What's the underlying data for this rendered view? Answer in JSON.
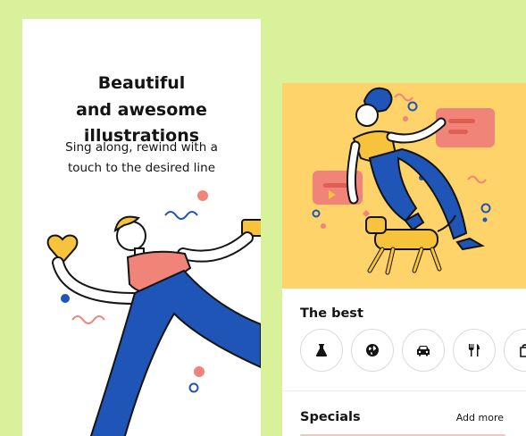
{
  "hero": {
    "title_lines": [
      "Beautiful",
      "and awesome",
      "illustrations"
    ],
    "subtitle_lines": [
      "Sing along, rewind with a",
      "touch to the desired line"
    ]
  },
  "sections": {
    "best_title": "The best",
    "specials_title": "Specials",
    "add_more_label": "Add more"
  },
  "categories": [
    {
      "icon": "flask-icon"
    },
    {
      "icon": "globe-icon"
    },
    {
      "icon": "car-icon"
    },
    {
      "icon": "cutlery-icon"
    },
    {
      "icon": "bag-icon"
    }
  ],
  "colors": {
    "background": "#d8f19a",
    "card": "#ffffff",
    "illustration_bg": "#fdd36a",
    "accent_blue": "#1e55b7",
    "accent_pink": "#f08479",
    "accent_yellow": "#f7c23c"
  }
}
